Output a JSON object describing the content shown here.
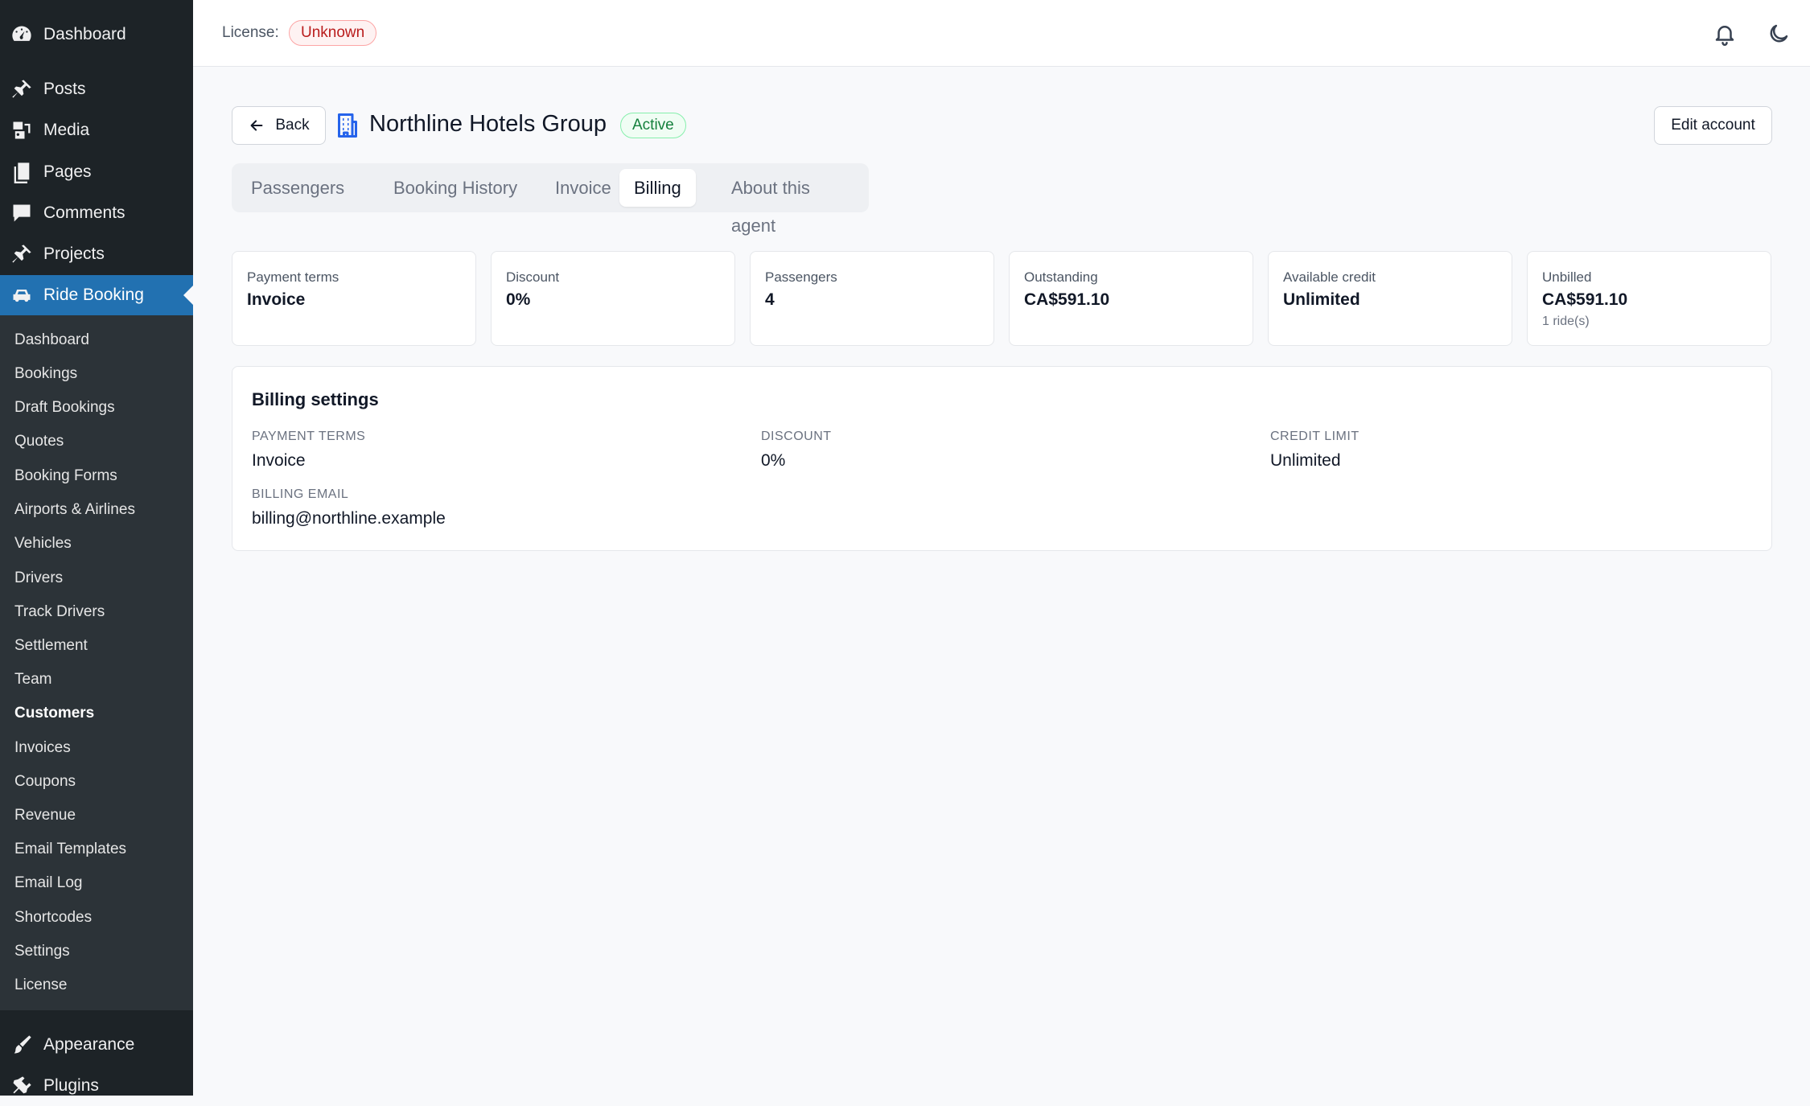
{
  "sidebar": {
    "top_items": [
      {
        "label": "Dashboard",
        "icon": "dashboard-icon"
      },
      {
        "label": "Posts",
        "icon": "pin-icon"
      },
      {
        "label": "Media",
        "icon": "media-icon"
      },
      {
        "label": "Pages",
        "icon": "pages-icon"
      },
      {
        "label": "Comments",
        "icon": "comment-icon"
      },
      {
        "label": "Projects",
        "icon": "pin-icon"
      },
      {
        "label": "Ride Booking",
        "icon": "car-icon"
      }
    ],
    "submenu": [
      "Dashboard",
      "Bookings",
      "Draft Bookings",
      "Quotes",
      "Booking Forms",
      "Airports & Airlines",
      "Vehicles",
      "Drivers",
      "Track Drivers",
      "Settlement",
      "Team",
      "Customers",
      "Invoices",
      "Coupons",
      "Revenue",
      "Email Templates",
      "Email Log",
      "Shortcodes",
      "Settings",
      "License"
    ],
    "current_submenu": "Customers",
    "bottom_items": [
      {
        "label": "Appearance",
        "icon": "brush-icon"
      },
      {
        "label": "Plugins",
        "icon": "plugin-icon"
      }
    ]
  },
  "topbar": {
    "license_label": "License:",
    "license_status": "Unknown"
  },
  "header": {
    "back_label": "Back",
    "title": "Northline Hotels Group",
    "status": "Active",
    "edit_label": "Edit account"
  },
  "tabs": [
    {
      "label": "Passengers",
      "active": false
    },
    {
      "label": "Booking History",
      "active": false
    },
    {
      "label": "Invoice",
      "active": false
    },
    {
      "label": "Billing",
      "active": true
    },
    {
      "label": "About this agent",
      "active": false
    }
  ],
  "stats": [
    {
      "label": "Payment terms",
      "value": "Invoice",
      "sub": ""
    },
    {
      "label": "Discount",
      "value": "0%",
      "sub": ""
    },
    {
      "label": "Passengers",
      "value": "4",
      "sub": ""
    },
    {
      "label": "Outstanding",
      "value": "CA$591.10",
      "sub": ""
    },
    {
      "label": "Available credit",
      "value": "Unlimited",
      "sub": ""
    },
    {
      "label": "Unbilled",
      "value": "CA$591.10",
      "sub": "1 ride(s)"
    }
  ],
  "billing_settings": {
    "title": "Billing settings",
    "payment_terms_label": "PAYMENT TERMS",
    "payment_terms": "Invoice",
    "discount_label": "DISCOUNT",
    "discount": "0%",
    "credit_limit_label": "CREDIT LIMIT",
    "credit_limit": "Unlimited",
    "billing_email_label": "BILLING EMAIL",
    "billing_email": "billing@northline.example"
  },
  "colors": {
    "sidebar_bg": "#1d2327",
    "active_menu": "#2271b1",
    "accent_blue": "#2563eb",
    "status_green": "#15803d",
    "license_red": "#b91c1c"
  }
}
